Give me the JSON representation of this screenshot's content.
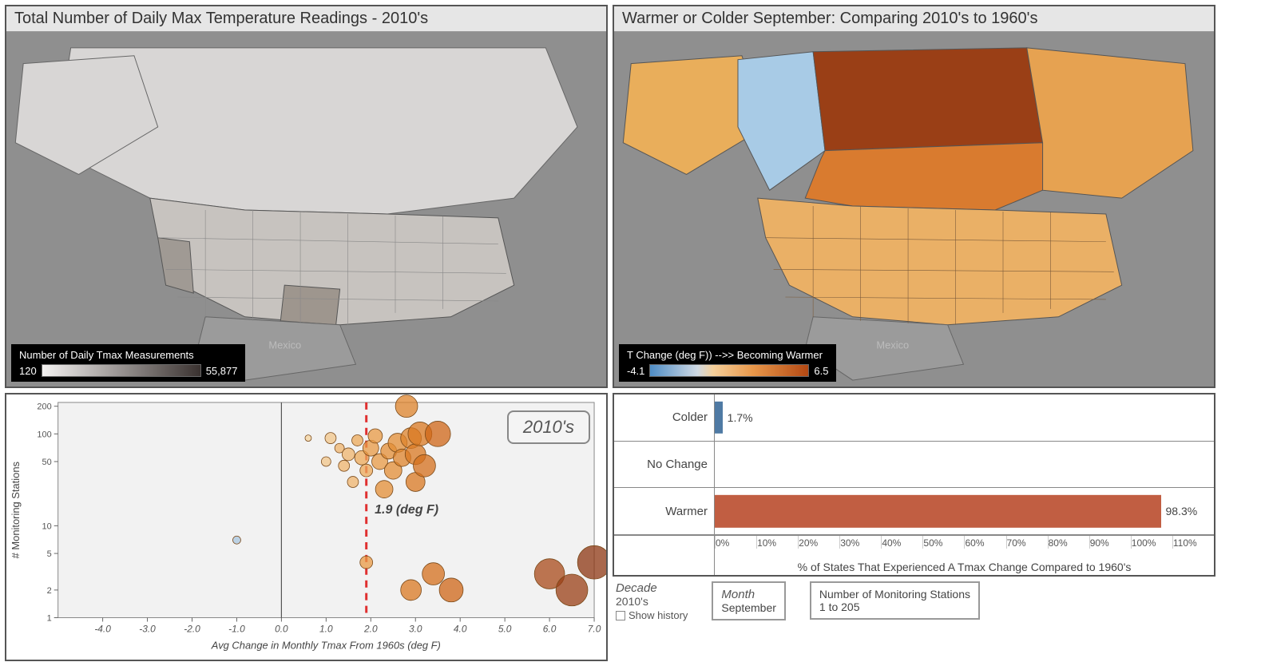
{
  "panels": {
    "left_map": {
      "title": "Total Number of Daily Max Temperature Readings - 2010's"
    },
    "right_map": {
      "title": "Warmer or Colder September: Comparing  2010's to 1960's"
    }
  },
  "legend_left": {
    "title": "Number of Daily Tmax Measurements",
    "min": "120",
    "max": "55,877"
  },
  "legend_right": {
    "title": "T Change (deg F)) -->> Becoming Warmer",
    "min": "-4.1",
    "max": "6.5"
  },
  "chart_data": [
    {
      "type": "bar",
      "orientation": "horizontal",
      "categories": [
        "Colder",
        "No Change",
        "Warmer"
      ],
      "values": [
        1.7,
        0,
        98.3
      ],
      "colors": [
        "#4f7aa4",
        "#888",
        "#c15e42"
      ],
      "xlabel": "% of States That Experienced A Tmax Change Compared to 1960's",
      "xlim": [
        0,
        110
      ],
      "xticks": [
        "0%",
        "10%",
        "20%",
        "30%",
        "40%",
        "50%",
        "60%",
        "70%",
        "80%",
        "90%",
        "100%",
        "110%"
      ]
    },
    {
      "type": "scatter",
      "title_badge": "2010's",
      "xlabel": "Avg Change in Monthly Tmax From 1960s (deg F)",
      "ylabel": "# Monitoring Stations",
      "xlim": [
        -5,
        7
      ],
      "xticks": [
        "-4.0",
        "-3.0",
        "-2.0",
        "-1.0",
        "0.0",
        "1.0",
        "2.0",
        "3.0",
        "4.0",
        "5.0",
        "6.0",
        "7.0"
      ],
      "yscale": "log",
      "yticks": [
        "1",
        "2",
        "5",
        "10",
        "50",
        "100",
        "200"
      ],
      "reference_line": {
        "x": 1.9,
        "label": "1.9 (deg F)",
        "color": "#e03030",
        "style": "dashed"
      },
      "points": [
        {
          "x": -1.0,
          "y": 7,
          "r": 5,
          "fill": "#a8c5df"
        },
        {
          "x": 0.6,
          "y": 90,
          "r": 4,
          "fill": "#f5d49f"
        },
        {
          "x": 1.0,
          "y": 50,
          "r": 6,
          "fill": "#f2c58a"
        },
        {
          "x": 1.1,
          "y": 90,
          "r": 7,
          "fill": "#f2c58a"
        },
        {
          "x": 1.3,
          "y": 70,
          "r": 6,
          "fill": "#efb46e"
        },
        {
          "x": 1.4,
          "y": 45,
          "r": 7,
          "fill": "#efb46e"
        },
        {
          "x": 1.5,
          "y": 60,
          "r": 8,
          "fill": "#efb46e"
        },
        {
          "x": 1.6,
          "y": 30,
          "r": 7,
          "fill": "#efb46e"
        },
        {
          "x": 1.7,
          "y": 85,
          "r": 7,
          "fill": "#eca95a"
        },
        {
          "x": 1.8,
          "y": 55,
          "r": 9,
          "fill": "#eca95a"
        },
        {
          "x": 1.9,
          "y": 40,
          "r": 8,
          "fill": "#eca95a"
        },
        {
          "x": 1.9,
          "y": 4,
          "r": 8,
          "fill": "#e89a44"
        },
        {
          "x": 2.0,
          "y": 70,
          "r": 10,
          "fill": "#e89a44"
        },
        {
          "x": 2.1,
          "y": 95,
          "r": 9,
          "fill": "#e89a44"
        },
        {
          "x": 2.2,
          "y": 50,
          "r": 10,
          "fill": "#e89a44"
        },
        {
          "x": 2.3,
          "y": 25,
          "r": 11,
          "fill": "#e38e36"
        },
        {
          "x": 2.4,
          "y": 65,
          "r": 10,
          "fill": "#e38e36"
        },
        {
          "x": 2.5,
          "y": 40,
          "r": 11,
          "fill": "#e38e36"
        },
        {
          "x": 2.6,
          "y": 80,
          "r": 12,
          "fill": "#e38e36"
        },
        {
          "x": 2.7,
          "y": 55,
          "r": 11,
          "fill": "#de832b"
        },
        {
          "x": 2.8,
          "y": 200,
          "r": 14,
          "fill": "#de832b"
        },
        {
          "x": 2.9,
          "y": 90,
          "r": 13,
          "fill": "#de832b"
        },
        {
          "x": 2.9,
          "y": 2,
          "r": 13,
          "fill": "#d97821"
        },
        {
          "x": 3.0,
          "y": 60,
          "r": 13,
          "fill": "#d97821"
        },
        {
          "x": 3.0,
          "y": 30,
          "r": 12,
          "fill": "#d97821"
        },
        {
          "x": 3.1,
          "y": 100,
          "r": 15,
          "fill": "#d97821"
        },
        {
          "x": 3.2,
          "y": 45,
          "r": 14,
          "fill": "#d46f1c"
        },
        {
          "x": 3.4,
          "y": 3,
          "r": 14,
          "fill": "#d46f1c"
        },
        {
          "x": 3.5,
          "y": 100,
          "r": 16,
          "fill": "#cf6517"
        },
        {
          "x": 3.8,
          "y": 2,
          "r": 15,
          "fill": "#cf6517"
        },
        {
          "x": 6.0,
          "y": 3,
          "r": 19,
          "fill": "#a8491a"
        },
        {
          "x": 6.5,
          "y": 2,
          "r": 20,
          "fill": "#9a3f16"
        },
        {
          "x": 7.0,
          "y": 4,
          "r": 21,
          "fill": "#8c3512"
        }
      ]
    }
  ],
  "controls": {
    "decade": {
      "label": "Decade",
      "value": "2010's",
      "show_history": "Show history"
    },
    "month": {
      "label": "Month",
      "value": "September"
    },
    "stations": {
      "label": "Number of Monitoring Stations",
      "value": "1 to 205"
    }
  }
}
